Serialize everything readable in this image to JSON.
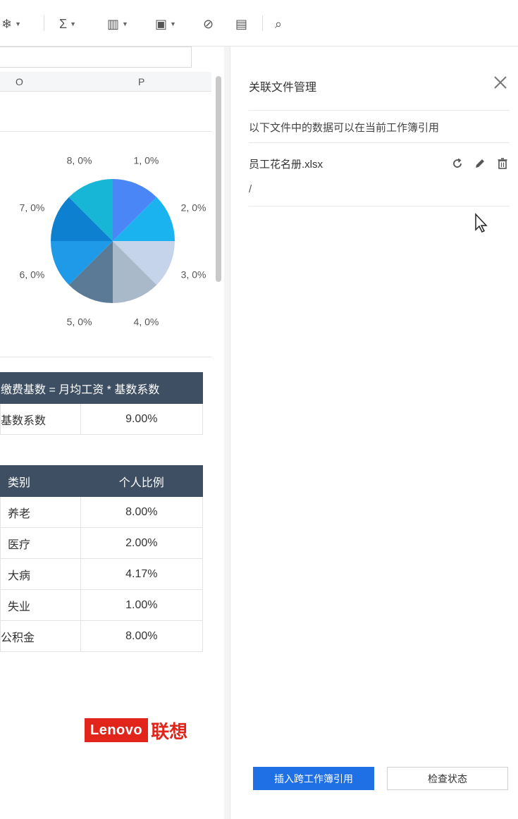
{
  "toolbar": {
    "items": [
      {
        "icon": "freeze-icon",
        "glyph": "❄"
      },
      {
        "icon": "sum-icon",
        "glyph": "Σ"
      },
      {
        "icon": "chart-icon",
        "glyph": "▥"
      },
      {
        "icon": "image-icon",
        "glyph": "▣"
      },
      {
        "icon": "link-icon",
        "glyph": "⊘"
      },
      {
        "icon": "comment-icon",
        "glyph": "▤"
      },
      {
        "icon": "search-icon",
        "glyph": "⌕"
      }
    ]
  },
  "sheet": {
    "columns": [
      "O",
      "P"
    ]
  },
  "chart_data": {
    "type": "pie",
    "categories": [
      "1",
      "2",
      "3",
      "4",
      "5",
      "6",
      "7",
      "8"
    ],
    "values": [
      12.5,
      12.5,
      12.5,
      12.5,
      12.5,
      12.5,
      12.5,
      12.5
    ],
    "labels": [
      "1, 0%",
      "2, 0%",
      "3, 0%",
      "4, 0%",
      "5, 0%",
      "6, 0%",
      "7, 0%",
      "8, 0%"
    ],
    "colors": [
      "#4a86f5",
      "#1ab3f0",
      "#c5d4ea",
      "#a9b9c9",
      "#5a7a96",
      "#1e9ae8",
      "#0d80d0",
      "#18b6d6"
    ],
    "title": "",
    "legend": "none"
  },
  "formula_table": {
    "header": "缴费基数 = 月均工资 * 基数系数",
    "row_label": "基数系数",
    "row_value": "9.00%"
  },
  "rate_table": {
    "headers": [
      "类别",
      "个人比例"
    ],
    "rows": [
      {
        "category": "养老",
        "ratio": "8.00%"
      },
      {
        "category": "医疗",
        "ratio": "2.00%"
      },
      {
        "category": "大病",
        "ratio": "4.17%"
      },
      {
        "category": "失业",
        "ratio": "1.00%"
      },
      {
        "category": "公积金",
        "ratio": "8.00%"
      }
    ]
  },
  "logo": {
    "brand_en": "Lenovo",
    "brand_cn": "联想",
    "color": "#e1251b"
  },
  "panel": {
    "title": "关联文件管理",
    "description": "以下文件中的数据可以在当前工作簿引用",
    "file_name": "员工花名册.xlsx",
    "file_path": "/",
    "insert_button": "插入跨工作簿引用",
    "check_button": "检查状态",
    "accent_color": "#1f6fe5"
  }
}
